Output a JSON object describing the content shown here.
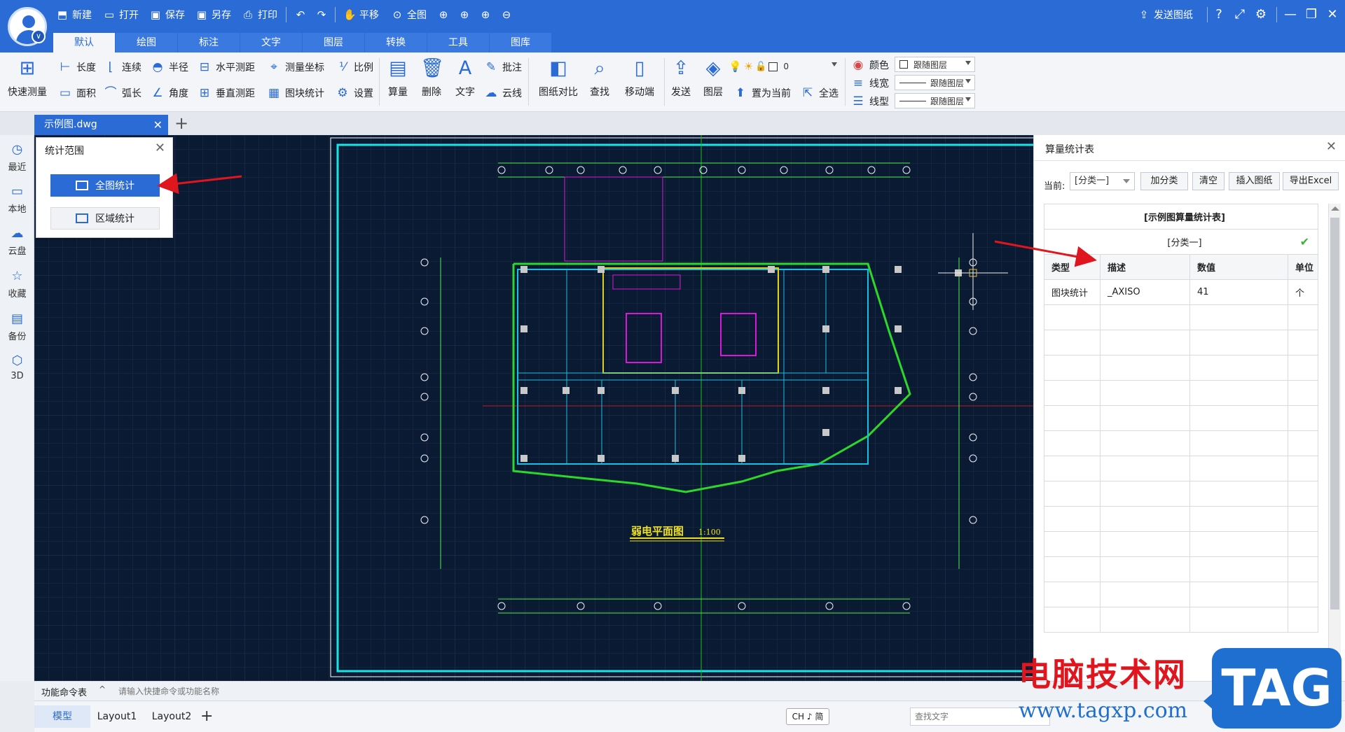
{
  "quick_access": {
    "new": "新建",
    "open": "打开",
    "save": "保存",
    "save_as": "另存",
    "print": "打印",
    "pan": "平移",
    "full_view": "全图"
  },
  "header_right": {
    "send_drawing": "发送图纸"
  },
  "tabs": [
    "默认",
    "绘图",
    "标注",
    "文字",
    "图层",
    "转换",
    "工具",
    "图库"
  ],
  "ribbon": {
    "quick_measure": "快速测量",
    "length": "长度",
    "area": "面积",
    "continuous": "连续",
    "arc_length": "弧长",
    "radius": "半径",
    "angle": "角度",
    "horizontal_measure": "水平测距",
    "vertical_measure": "垂直测距",
    "measure_coord": "测量坐标",
    "block_stats": "图块统计",
    "scale": "比例",
    "settings": "设置",
    "calc": "算量",
    "delete": "删除",
    "text": "文字",
    "annotate": "批注",
    "cloud_line": "云线",
    "compare": "图纸对比",
    "find": "查找",
    "mobile": "移动端",
    "send": "发送",
    "layer": "图层",
    "set_current": "置为当前",
    "select_all": "全选",
    "layer_value": "0",
    "color_label": "颜色",
    "linewidth_label": "线宽",
    "linetype_label": "线型",
    "color_value": "跟随图层",
    "linewidth_value": "跟随图层",
    "linetype_value": "跟随图层"
  },
  "doc_tab": {
    "filename": "示例图.dwg"
  },
  "sidebar": [
    "最近",
    "本地",
    "云盘",
    "收藏",
    "备份",
    "3D"
  ],
  "scope_panel": {
    "title": "统计范围",
    "full_button": "全图统计",
    "region_button": "区域统计"
  },
  "stats_panel": {
    "title": "算量统计表",
    "current_label": "当前:",
    "current_value": "[分类一]",
    "buttons": [
      "加分类",
      "清空",
      "插入图纸",
      "导出Excel"
    ],
    "table_caption": "[示例图算量统计表]",
    "category_row": "[分类一]",
    "headers": [
      "类型",
      "描述",
      "数值",
      "单位"
    ],
    "rows": [
      [
        "图块统计",
        "_AXISO",
        "41",
        "个"
      ]
    ]
  },
  "drawing": {
    "title": "弱电平面图",
    "scale": "1:100"
  },
  "command_bar": {
    "label": "功能命令表",
    "placeholder": "请输入快捷命令或功能名称"
  },
  "layout_tabs": [
    "模型",
    "Layout1",
    "Layout2"
  ],
  "ime": "CH ♪ 简",
  "find_placeholder": "查找文字",
  "watermark": {
    "text": "电脑技术网",
    "url": "www.tagxp.com",
    "tag": "TAG"
  },
  "colors": {
    "brand": "#2a6bd6",
    "canvas": "#0b1a33",
    "arrow": "#e0161e"
  }
}
